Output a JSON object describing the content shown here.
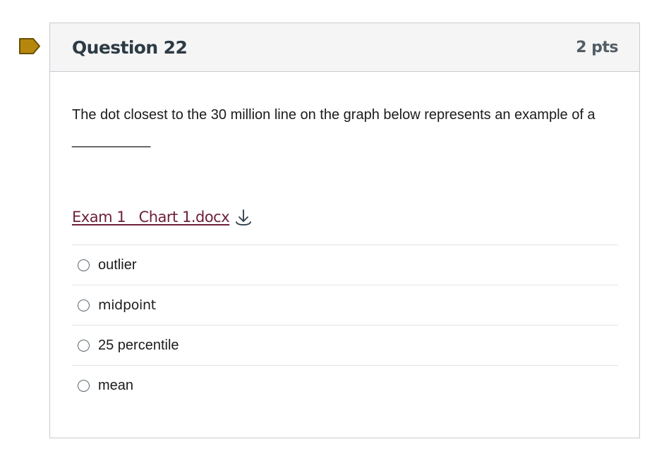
{
  "question": {
    "title": "Question 22",
    "points": "2 pts",
    "flag_icon": "bookmark-flag-icon",
    "flag_color": "#b5870d",
    "text": "The dot closest to the 30 million line on the graph below represents an example of a __________",
    "attachment": {
      "label": "Exam 1   Chart 1.docx",
      "icon": "download-icon",
      "color": "#6d1f3b"
    },
    "answers": [
      {
        "label": "outlier"
      },
      {
        "label": "midpoint"
      },
      {
        "label": "25 percentile"
      },
      {
        "label": "mean"
      }
    ]
  }
}
